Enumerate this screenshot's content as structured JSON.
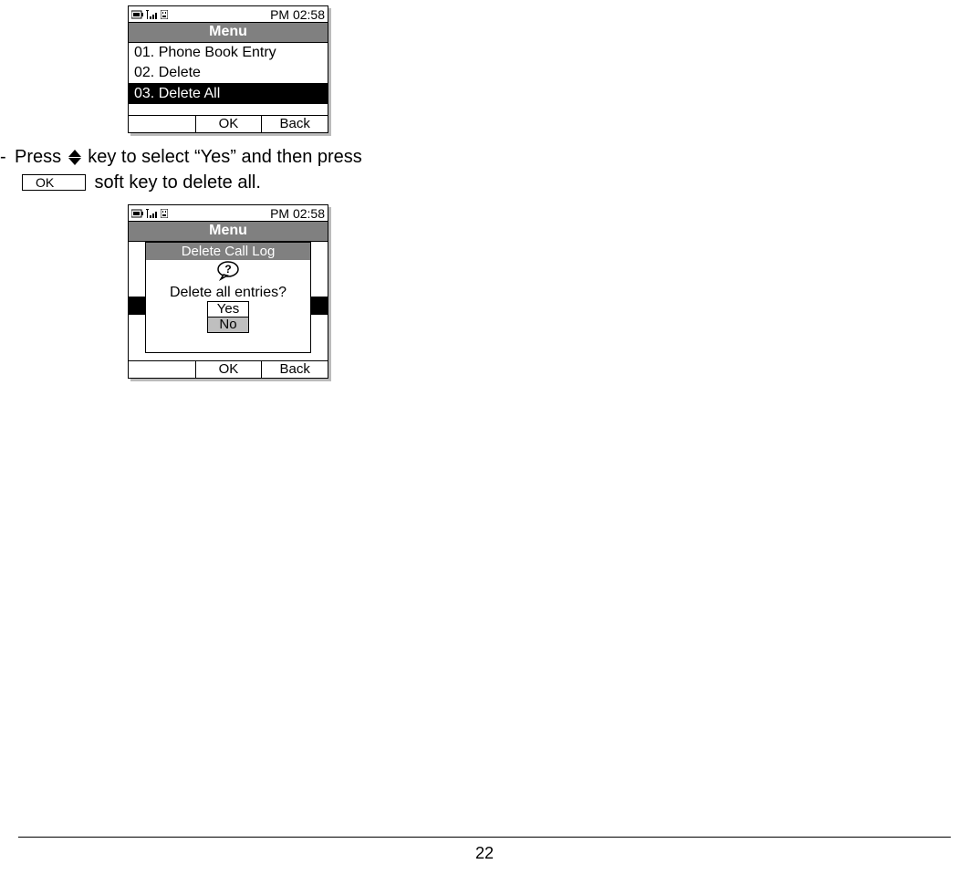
{
  "screen1": {
    "time": "PM 02:58",
    "title": "Menu",
    "items": [
      "01. Phone Book Entry",
      "02. Delete",
      "03. Delete All"
    ],
    "softkeys": {
      "left": "",
      "center": "OK",
      "right": "Back"
    }
  },
  "instruction": {
    "pre_icon": "Press ",
    "post_icon": " key to select “Yes” and then press",
    "post_ok": " soft key to delete all.",
    "ok_label": "OK"
  },
  "screen2": {
    "time": "PM 02:58",
    "title": "Menu",
    "dialog_title": "Delete Call Log",
    "dialog_msg": "Delete all entries?",
    "option_yes": "Yes",
    "option_no": "No",
    "softkeys": {
      "left": "",
      "center": "OK",
      "right": "Back"
    }
  },
  "page_number": "22"
}
